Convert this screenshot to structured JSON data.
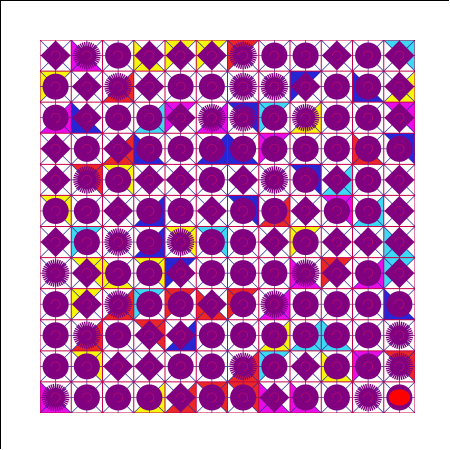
{
  "board": {
    "rows": 12,
    "cols": 12,
    "colors": {
      "background": "#ffffff",
      "grid_line": "#c4004a",
      "diagonal_line": "#2a2aa0",
      "piece": "#800080",
      "piece_spiral": "#cc1166",
      "corner_red": "#e81b1b",
      "corner_blue": "#1a1ad6",
      "corner_magenta": "#e600e6",
      "corner_cyan": "#33d6f0",
      "corner_yellow": "#f5f500",
      "cursor": "#ff0000",
      "frame": "#000000"
    },
    "piece_types": [
      "circle",
      "diamond",
      "spiky"
    ],
    "cells": [
      [
        "diamond",
        "spiky",
        "circle",
        "diamond",
        "diamond",
        "diamond",
        "spiky",
        "circle",
        "circle",
        "diamond",
        "circle",
        "diamond"
      ],
      [
        "circle",
        "diamond",
        "spiky",
        "diamond",
        "circle",
        "circle",
        "spiky",
        "spiky",
        "diamond",
        "circle",
        "circle",
        "diamond"
      ],
      [
        "circle",
        "diamond",
        "circle",
        "circle",
        "diamond",
        "spiky",
        "spiky",
        "circle",
        "spiky",
        "circle",
        "circle",
        "diamond"
      ],
      [
        "diamond",
        "circle",
        "diamond",
        "circle",
        "circle",
        "circle",
        "circle",
        "circle",
        "circle",
        "circle",
        "circle",
        "circle"
      ],
      [
        "diamond",
        "spiky",
        "circle",
        "diamond",
        "diamond",
        "circle",
        "diamond",
        "spiky",
        "circle",
        "diamond",
        "circle",
        "diamond"
      ],
      [
        "circle",
        "circle",
        "diamond",
        "circle",
        "circle",
        "diamond",
        "circle",
        "circle",
        "diamond",
        "circle",
        "circle",
        "diamond"
      ],
      [
        "diamond",
        "circle",
        "spiky",
        "circle",
        "spiky",
        "circle",
        "circle",
        "diamond",
        "circle",
        "diamond",
        "diamond",
        "diamond"
      ],
      [
        "spiky",
        "diamond",
        "circle",
        "circle",
        "diamond",
        "circle",
        "circle",
        "circle",
        "spiky",
        "diamond",
        "circle",
        "diamond"
      ],
      [
        "circle",
        "diamond",
        "spiky",
        "circle",
        "circle",
        "diamond",
        "circle",
        "spiky",
        "circle",
        "circle",
        "circle",
        "circle"
      ],
      [
        "circle",
        "spiky",
        "circle",
        "diamond",
        "diamond",
        "circle",
        "circle",
        "circle",
        "circle",
        "circle",
        "circle",
        "spiky"
      ],
      [
        "circle",
        "circle",
        "diamond",
        "diamond",
        "circle",
        "circle",
        "spiky",
        "circle",
        "diamond",
        "circle",
        "circle",
        "spiky"
      ],
      [
        "spiky",
        "circle",
        "circle",
        "circle",
        "diamond",
        "circle",
        "circle",
        "diamond",
        "circle",
        "circle",
        "spiky",
        "circle"
      ]
    ],
    "cursor_cell": [
      11,
      11
    ]
  }
}
